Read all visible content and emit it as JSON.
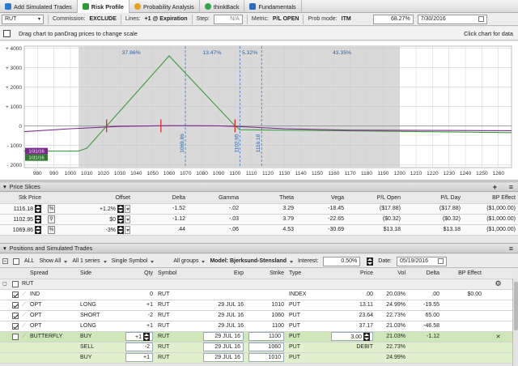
{
  "tabs": [
    {
      "label": "Add Simulated Trades",
      "icon": "plus-icon",
      "color": "#2a7ad1"
    },
    {
      "label": "Risk Profile",
      "icon": "risk-profile-icon",
      "color": "#2e9a3a",
      "active": true
    },
    {
      "label": "Probability Analysis",
      "icon": "probability-icon",
      "color": "#e8a020"
    },
    {
      "label": "thinkBack",
      "icon": "thinkback-icon",
      "color": "#37a04a"
    },
    {
      "label": "Fundamentals",
      "icon": "fundamentals-icon",
      "color": "#2a6bc1"
    }
  ],
  "toolbar": {
    "symbol": "RUT",
    "commission_label": "Commission:",
    "commission_value": "EXCLUDE",
    "lines_label": "Lines:",
    "lines_value": "+1 @ Expiration",
    "step_label": "Step:",
    "step_value": "N/A",
    "metric_label": "Metric:",
    "metric_value": "P/L OPEN",
    "prob_label": "Prob mode:",
    "prob_value": "ITM",
    "percent": "68.27%",
    "date": "7/30/2016"
  },
  "infobar": {
    "drag_text": "Drag chart to panDrag prices to change scale",
    "click_text": "Click chart for data"
  },
  "chart_data": {
    "type": "line",
    "x_ticks": [
      980,
      990,
      1000,
      1010,
      1020,
      1030,
      1040,
      1050,
      1060,
      1070,
      1080,
      1090,
      1100,
      1110,
      1120,
      1130,
      1140,
      1150,
      1160,
      1170,
      1180,
      1190,
      1200,
      1210,
      1220,
      1230,
      1240,
      1250,
      1260
    ],
    "y_ticks": [
      4000,
      3000,
      2000,
      1000,
      0,
      -1000,
      -2000
    ],
    "y_tick_labels": [
      "+ 4000",
      "+ 3000",
      "+ 2000",
      "+ 1000",
      "0",
      "- 1000",
      "- 2000"
    ],
    "xlim": [
      972,
      1268
    ],
    "ylim": [
      -2150,
      4100
    ],
    "shaded_range": [
      1005,
      1200
    ],
    "series": [
      {
        "color": "#3e9a3e",
        "points": [
          [
            972,
            -1300
          ],
          [
            1005,
            -1300
          ],
          [
            1010,
            -1150
          ],
          [
            1060,
            3600
          ],
          [
            1100,
            0
          ],
          [
            1103,
            -200
          ],
          [
            1268,
            -350
          ]
        ]
      },
      {
        "color": "#7a2a8a",
        "points": [
          [
            972,
            -300
          ],
          [
            1000,
            -150
          ],
          [
            1030,
            -30
          ],
          [
            1060,
            10
          ],
          [
            1090,
            0
          ],
          [
            1100,
            -30
          ],
          [
            1130,
            -150
          ],
          [
            1170,
            -220
          ],
          [
            1268,
            -250
          ]
        ]
      }
    ],
    "dashed_lines": [
      {
        "x": 1069.86,
        "label": "1069.86"
      },
      {
        "x": 1102.95,
        "label": "1102.95"
      },
      {
        "x": 1116.18,
        "label": "1116.18"
      }
    ],
    "probability_labels": [
      {
        "x": 1037,
        "text": "37.86%"
      },
      {
        "x": 1086,
        "text": "13.47%"
      },
      {
        "x": 1109,
        "text": "5.32%"
      },
      {
        "x": 1165,
        "text": "43.35%"
      }
    ],
    "markers": [
      {
        "x": 1022
      },
      {
        "x": 1055
      },
      {
        "x": 1100
      }
    ],
    "left_badges": [
      "1/31/16",
      "1/31/16"
    ]
  },
  "price_slices": {
    "title": "Price Slices",
    "headers": [
      "Stk Price",
      "Offset",
      "Delta",
      "Gamma",
      "Theta",
      "Vega",
      "P/L Open",
      "P/L Day",
      "BP Effect"
    ],
    "rows": [
      {
        "price": "1116.18",
        "offset": "+1.2%",
        "delta": "-1.52",
        "gamma": "-.02",
        "theta": "3.29",
        "vega": "-18.45",
        "pl_open": "($17.88)",
        "pl_day": "($17.88)",
        "bp": "($1,000.00)"
      },
      {
        "price": "1102.95",
        "offset": "$0",
        "delta": "-1.12",
        "gamma": "-.03",
        "theta": "3.79",
        "vega": "-22.65",
        "pl_open": "($0.32)",
        "pl_day": "($0.32)",
        "bp": "($1,000.00)"
      },
      {
        "price": "1069.86",
        "offset": "-3%",
        "delta": ".44",
        "gamma": "-.06",
        "theta": "4.53",
        "vega": "-30.69",
        "pl_open": "$13.18",
        "pl_day": "$13.18",
        "bp": "($1,000.00)"
      }
    ]
  },
  "positions": {
    "title": "Positions and Simulated Trades",
    "all_label": "ALL",
    "show_all": "Show All",
    "series_filter": "All 1 series",
    "symbol_filter": "Single Symbol",
    "groups_filter": "All groups",
    "model_label": "Model: Bjerksund-Stensland",
    "interest_label": "Interest:",
    "interest_value": "0.50%",
    "date_label": "Date:",
    "date_value": "05/19/2016",
    "headers": [
      "Spread",
      "Side",
      "Qty",
      "Symbol",
      "Exp",
      "Strike",
      "Type",
      "Price",
      "Vol",
      "Delta",
      "BP Effect"
    ],
    "group_label": "RUT",
    "rows": [
      {
        "spread": "IND",
        "side": "",
        "qty": "0",
        "symbol": "RUT",
        "exp": "",
        "strike": "",
        "type": "INDEX",
        "price": ".00",
        "vol": "20.03%",
        "delta": ".00",
        "bp": "$0.00"
      },
      {
        "spread": "OPT",
        "side": "LONG",
        "qty": "+1",
        "symbol": "RUT",
        "exp": "29 JUL 16",
        "strike": "1010",
        "type": "PUT",
        "price": "13.11",
        "vol": "24.99%",
        "delta": "-19.55",
        "bp": ""
      },
      {
        "spread": "OPT",
        "side": "SHORT",
        "qty": "-2",
        "symbol": "RUT",
        "exp": "29 JUL 16",
        "strike": "1060",
        "type": "PUT",
        "price": "23.64",
        "vol": "22.73%",
        "delta": "65.00",
        "bp": ""
      },
      {
        "spread": "OPT",
        "side": "LONG",
        "qty": "+1",
        "symbol": "RUT",
        "exp": "29 JUL 16",
        "strike": "1100",
        "type": "PUT",
        "price": "37.17",
        "vol": "21.03%",
        "delta": "-46.58",
        "bp": ""
      }
    ],
    "sim_rows": [
      {
        "spread": "BUTTERFLY",
        "side": "BUY",
        "qty": "+1",
        "symbol": "RUT",
        "exp": "29 JUL 16",
        "strike": "1100",
        "type": "PUT",
        "price": "3.00",
        "vol": "21.03%",
        "delta": "-1.12",
        "bp": ""
      },
      {
        "spread": "",
        "side": "SELL",
        "qty": "-2",
        "symbol": "RUT",
        "exp": "29 JUL 16",
        "strike": "1060",
        "type": "PUT",
        "price": "DEBIT",
        "vol": "22.73%",
        "delta": "",
        "bp": ""
      },
      {
        "spread": "",
        "side": "BUY",
        "qty": "+1",
        "symbol": "RUT",
        "exp": "29 JUL 16",
        "strike": "1010",
        "type": "PUT",
        "price": "",
        "vol": "24.99%",
        "delta": "",
        "bp": ""
      }
    ]
  }
}
